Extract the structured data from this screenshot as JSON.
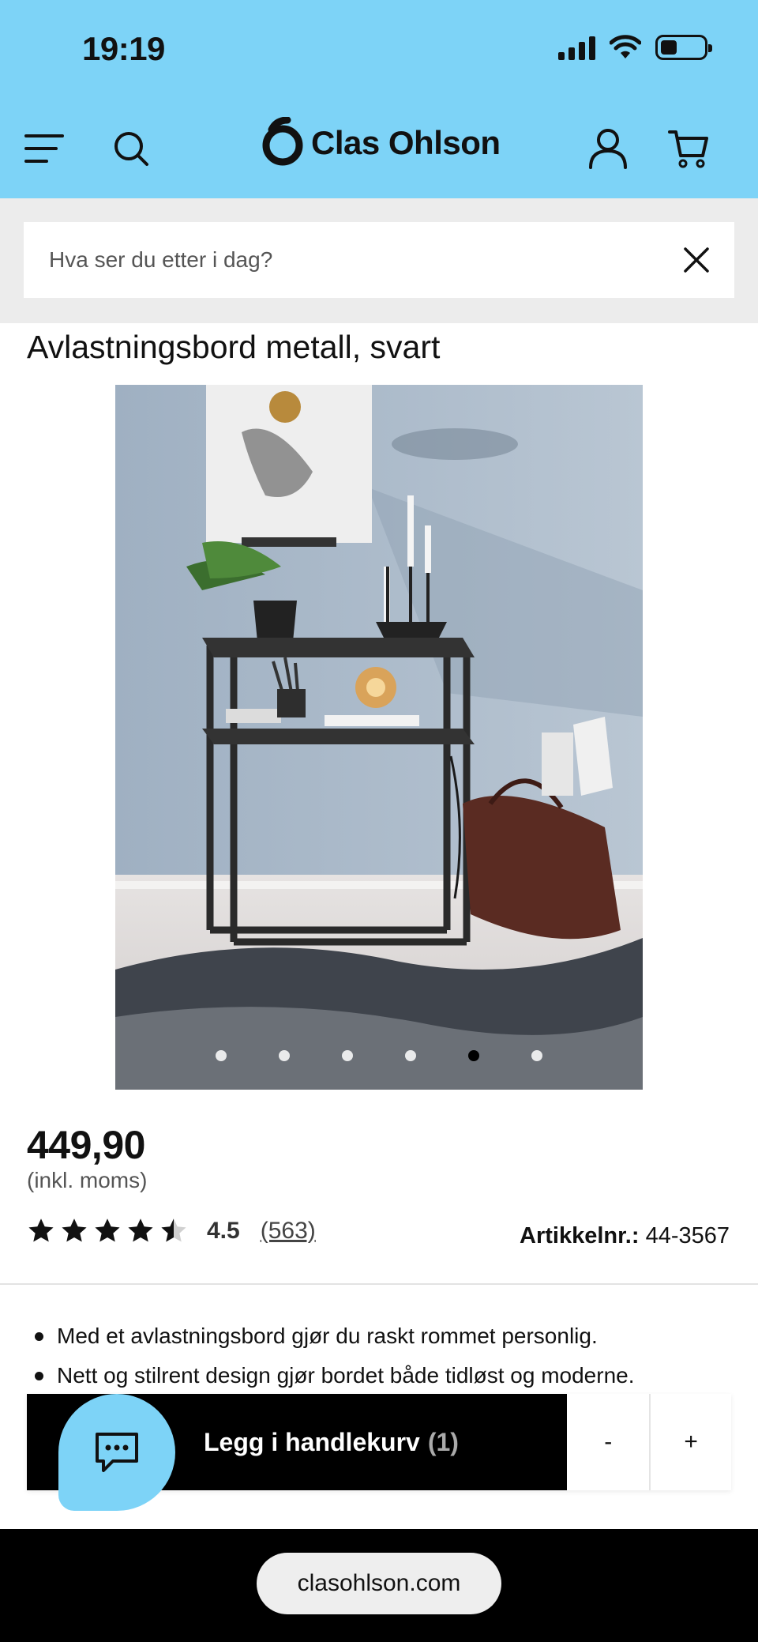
{
  "status_bar": {
    "time": "19:19"
  },
  "header": {
    "brand": "Clas Ohlson",
    "colors": {
      "header_bg": "#7dd3f7"
    },
    "icons": [
      "menu-icon",
      "search-icon",
      "user-icon",
      "cart-icon"
    ]
  },
  "search": {
    "placeholder": "Hva ser du etter i dag?"
  },
  "product": {
    "title": "Avlastningsbord metall, svart",
    "price": "449,90",
    "vat_note": "(inkl. moms)",
    "rating": {
      "value": "4.5",
      "count": "(563)",
      "stars": 4.5,
      "max_stars": 5
    },
    "article_label": "Artikkelnr.:",
    "article_number": "44-3567",
    "image_carousel": {
      "total": 6,
      "active_index": 4
    },
    "bullets": [
      "Med et avlastningsbord gjør du raskt rommet personlig.",
      "Nett og stilrent design gjør bordet både tidløst og moderne."
    ]
  },
  "cart_bar": {
    "add_label": "Legg i handlekurv",
    "quantity": "(1)",
    "minus": "-",
    "plus": "+"
  },
  "browser": {
    "url": "clasohlson.com"
  }
}
